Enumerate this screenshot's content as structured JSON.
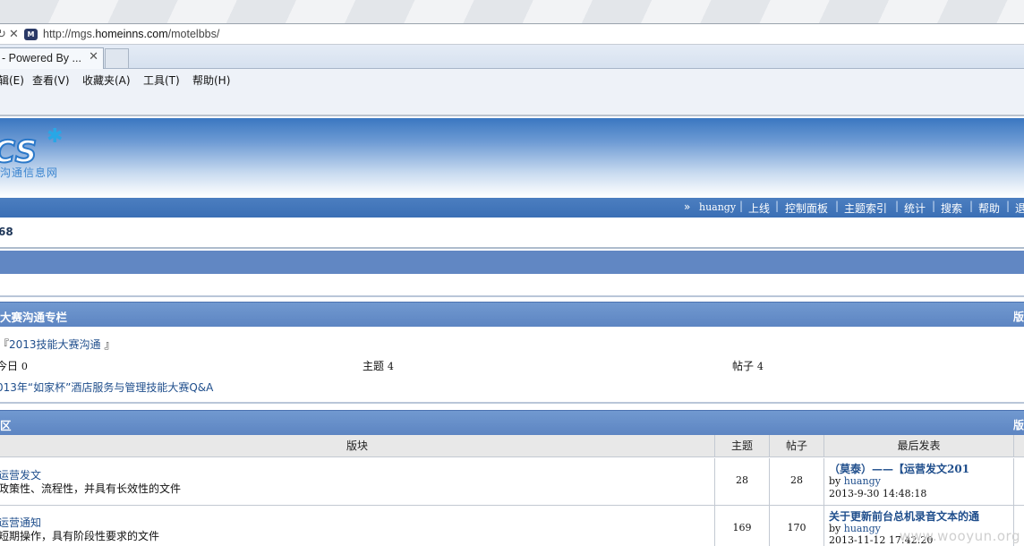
{
  "browser": {
    "url_prefix": "http://mgs.",
    "url_domain": "homeinns.com",
    "url_path": "/motelbbs/",
    "tab_title": "- Powered By ...",
    "menu": [
      "辑(E)",
      "查看(V)",
      "收藏夹(A)",
      "工具(T)",
      "帮助(H)"
    ]
  },
  "header": {
    "logo_text": "CS",
    "logo_sub": "沟通信息网",
    "nav_arrow": "»",
    "user": "huangy",
    "nav_items": [
      "上线",
      "控制面板",
      "主题索引",
      "统计",
      "搜索",
      "帮助",
      "退"
    ],
    "uid": "68"
  },
  "contest": {
    "title": "大赛沟通专栏",
    "edge": "版",
    "forum_link": "2013技能大赛沟通",
    "forum_prefix": "『",
    "forum_suffix": "』",
    "today_label": "今日",
    "today_value": "0",
    "topics_label": "主题",
    "topics_value": "4",
    "posts_label": "帖子",
    "posts_value": "4",
    "latest": "013年“如家杯”酒店服务与管理技能大赛Q&A"
  },
  "zone": {
    "title": "区",
    "edge": "版",
    "columns": [
      "版块",
      "主题",
      "帖子",
      "最后发表"
    ],
    "rows": [
      {
        "name": "运营发文",
        "desc": "政策性、流程性，并具有长效性的文件",
        "topics": "28",
        "posts": "28",
        "last_title": "（莫泰）——【运营发文201",
        "by_label": "by",
        "last_by": "huangy",
        "last_time": "2013-9-30 14:48:18"
      },
      {
        "name": "运营通知",
        "desc": "短期操作，具有阶段性要求的文件",
        "topics": "169",
        "posts": "170",
        "last_title": "关于更新前台总机录音文本的通",
        "by_label": "by",
        "last_by": "huangy",
        "last_time": "2013-11-12 17:42:20"
      }
    ]
  },
  "watermark": "www.wooyun.org"
}
